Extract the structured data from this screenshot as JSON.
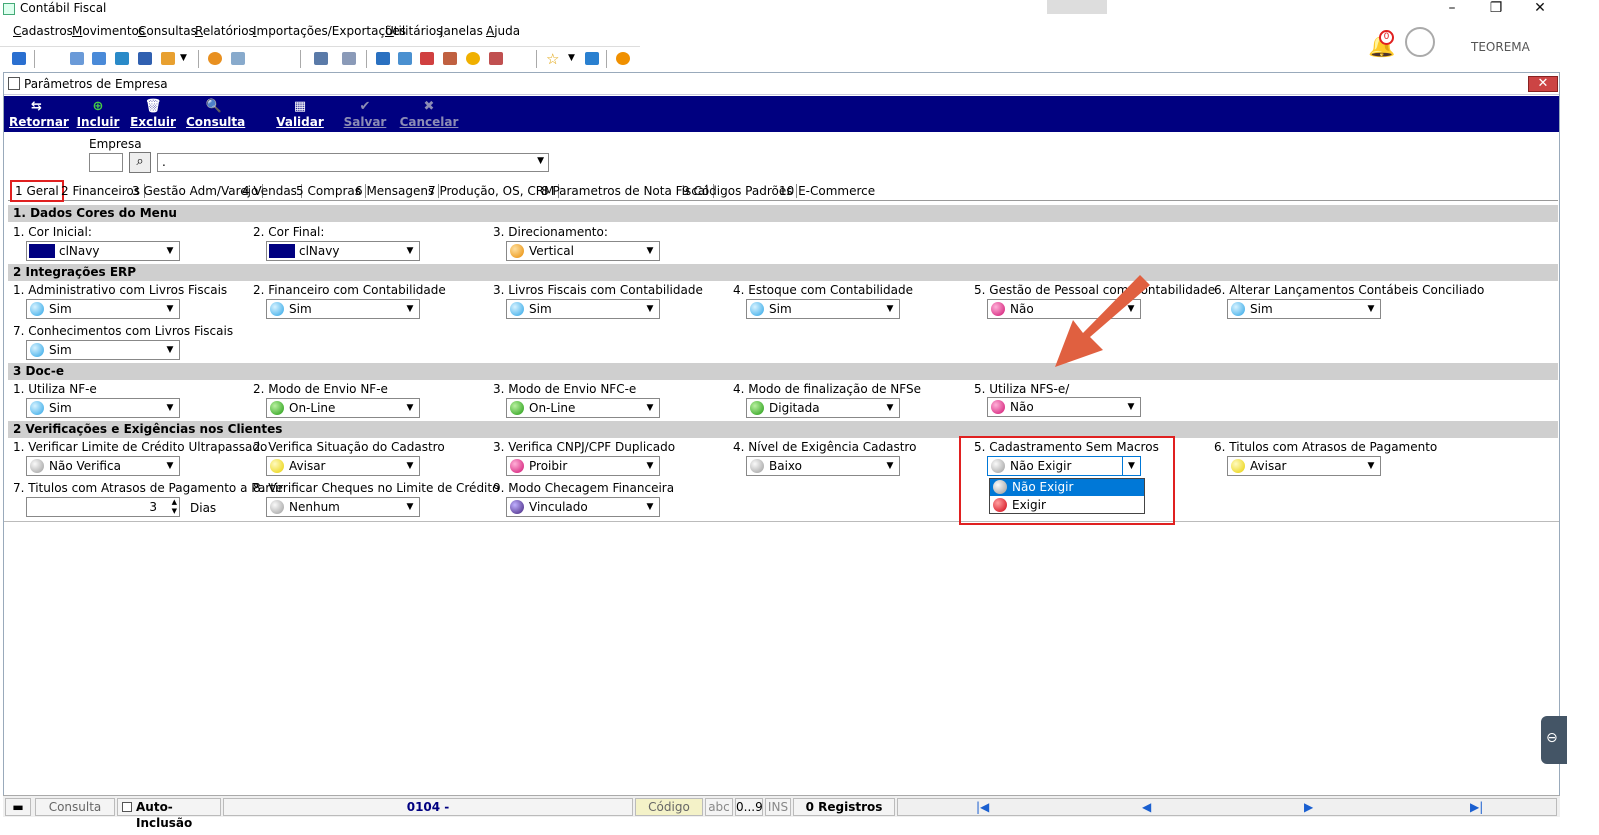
{
  "app_title": "Contábil Fiscal",
  "menu": [
    "Cadastros",
    "Movimentos",
    "Consultas",
    "Relatórios",
    "Importações/Exportações",
    "Utilitários",
    "Janelas",
    "Ajuda"
  ],
  "notification_count": "0",
  "user": "TEOREMA",
  "window_title": "Parâmetros de Empresa",
  "actions": {
    "retornar": "Retornar",
    "incluir": "Incluir",
    "excluir": "Excluir",
    "consulta": "Consulta",
    "validar": "Validar",
    "salvar": "Salvar",
    "cancelar": "Cancelar"
  },
  "empresa": {
    "label": "Empresa",
    "code": "",
    "name": "."
  },
  "tabs": [
    "1 Geral",
    "2 Financeiros",
    "3 Gestão Adm/Varejo",
    "4 Vendas",
    "5 Compras",
    "6 Mensagens",
    "7 Produção, OS, CRM",
    "8 Parametros de Nota Fiscal",
    "9 Códigos Padrões",
    "10 E-Commerce"
  ],
  "sections": {
    "s1": {
      "title": "1.  Dados Cores do Menu",
      "f1": {
        "label": "1. Cor Inicial:",
        "value": "clNavy"
      },
      "f2": {
        "label": "2. Cor Final:",
        "value": "clNavy"
      },
      "f3": {
        "label": "3. Direcionamento:",
        "value": "Vertical"
      }
    },
    "s2": {
      "title": "2 Integrações ERP",
      "f1": {
        "label": "1. Administrativo com Livros Fiscais",
        "value": "Sim"
      },
      "f2": {
        "label": "2. Financeiro com Contabilidade",
        "value": "Sim"
      },
      "f3": {
        "label": "3. Livros Fiscais com Contabilidade",
        "value": "Sim"
      },
      "f4": {
        "label": "4. Estoque com Contabilidade",
        "value": "Sim"
      },
      "f5": {
        "label": "5. Gestão de Pessoal com Contabilidade",
        "value": "Não"
      },
      "f6": {
        "label": "6. Alterar Lançamentos Contábeis Conciliado",
        "value": "Sim"
      },
      "f7": {
        "label": "7. Conhecimentos com Livros Fiscais",
        "value": "Sim"
      }
    },
    "s3": {
      "title": "3  Doc-e",
      "f1": {
        "label": "1. Utiliza NF-e",
        "value": "Sim"
      },
      "f2": {
        "label": "2. Modo de Envio NF-e",
        "value": "On-Line"
      },
      "f3": {
        "label": "3. Modo de Envio NFC-e",
        "value": "On-Line"
      },
      "f4": {
        "label": "4. Modo de finalização de NFSe",
        "value": "Digitada"
      },
      "f5": {
        "label": "5. Utiliza NFS-e/",
        "value": "Não"
      }
    },
    "s4": {
      "title": "2 Verificações e Exigências nos Clientes",
      "f1": {
        "label": "1. Verificar Limite de Crédito Ultrapassado",
        "value": "Não Verifica"
      },
      "f2": {
        "label": "2. Verifica Situação do Cadastro",
        "value": "Avisar"
      },
      "f3": {
        "label": "3. Verifica CNPJ/CPF Duplicado",
        "value": "Proibir"
      },
      "f4": {
        "label": "4. Nível de Exigência Cadastro",
        "value": "Baixo"
      },
      "f5": {
        "label": "5. Cadastramento Sem Macros",
        "value": "Não Exigir"
      },
      "f6": {
        "label": "6. Titulos com Atrasos de Pagamento",
        "value": "Avisar"
      },
      "f7": {
        "label": "7. Titulos com Atrasos de Pagamento a Partir",
        "value": "3",
        "unit": "Dias"
      },
      "f8": {
        "label": "8. Verificar Cheques no Limite de Crédito",
        "value": "Nenhum"
      },
      "f9": {
        "label": "9. Modo Checagem Financeira",
        "value": "Vinculado"
      }
    }
  },
  "dropdown_options": [
    "Não Exigir",
    "Exigir"
  ],
  "status": {
    "mode": "Consulta",
    "auto": "Auto-Inclusão",
    "code": "0104 -",
    "codigo": "Código",
    "abc": "abc",
    "num": "0...9",
    "ins": "INS",
    "registros": "0 Registros",
    "nav": [
      "|◀",
      "◀",
      "▶",
      "▶|"
    ]
  },
  "colors": {
    "navy": "#000080",
    "highlight": "#e02020",
    "selected": "#0078d7"
  }
}
